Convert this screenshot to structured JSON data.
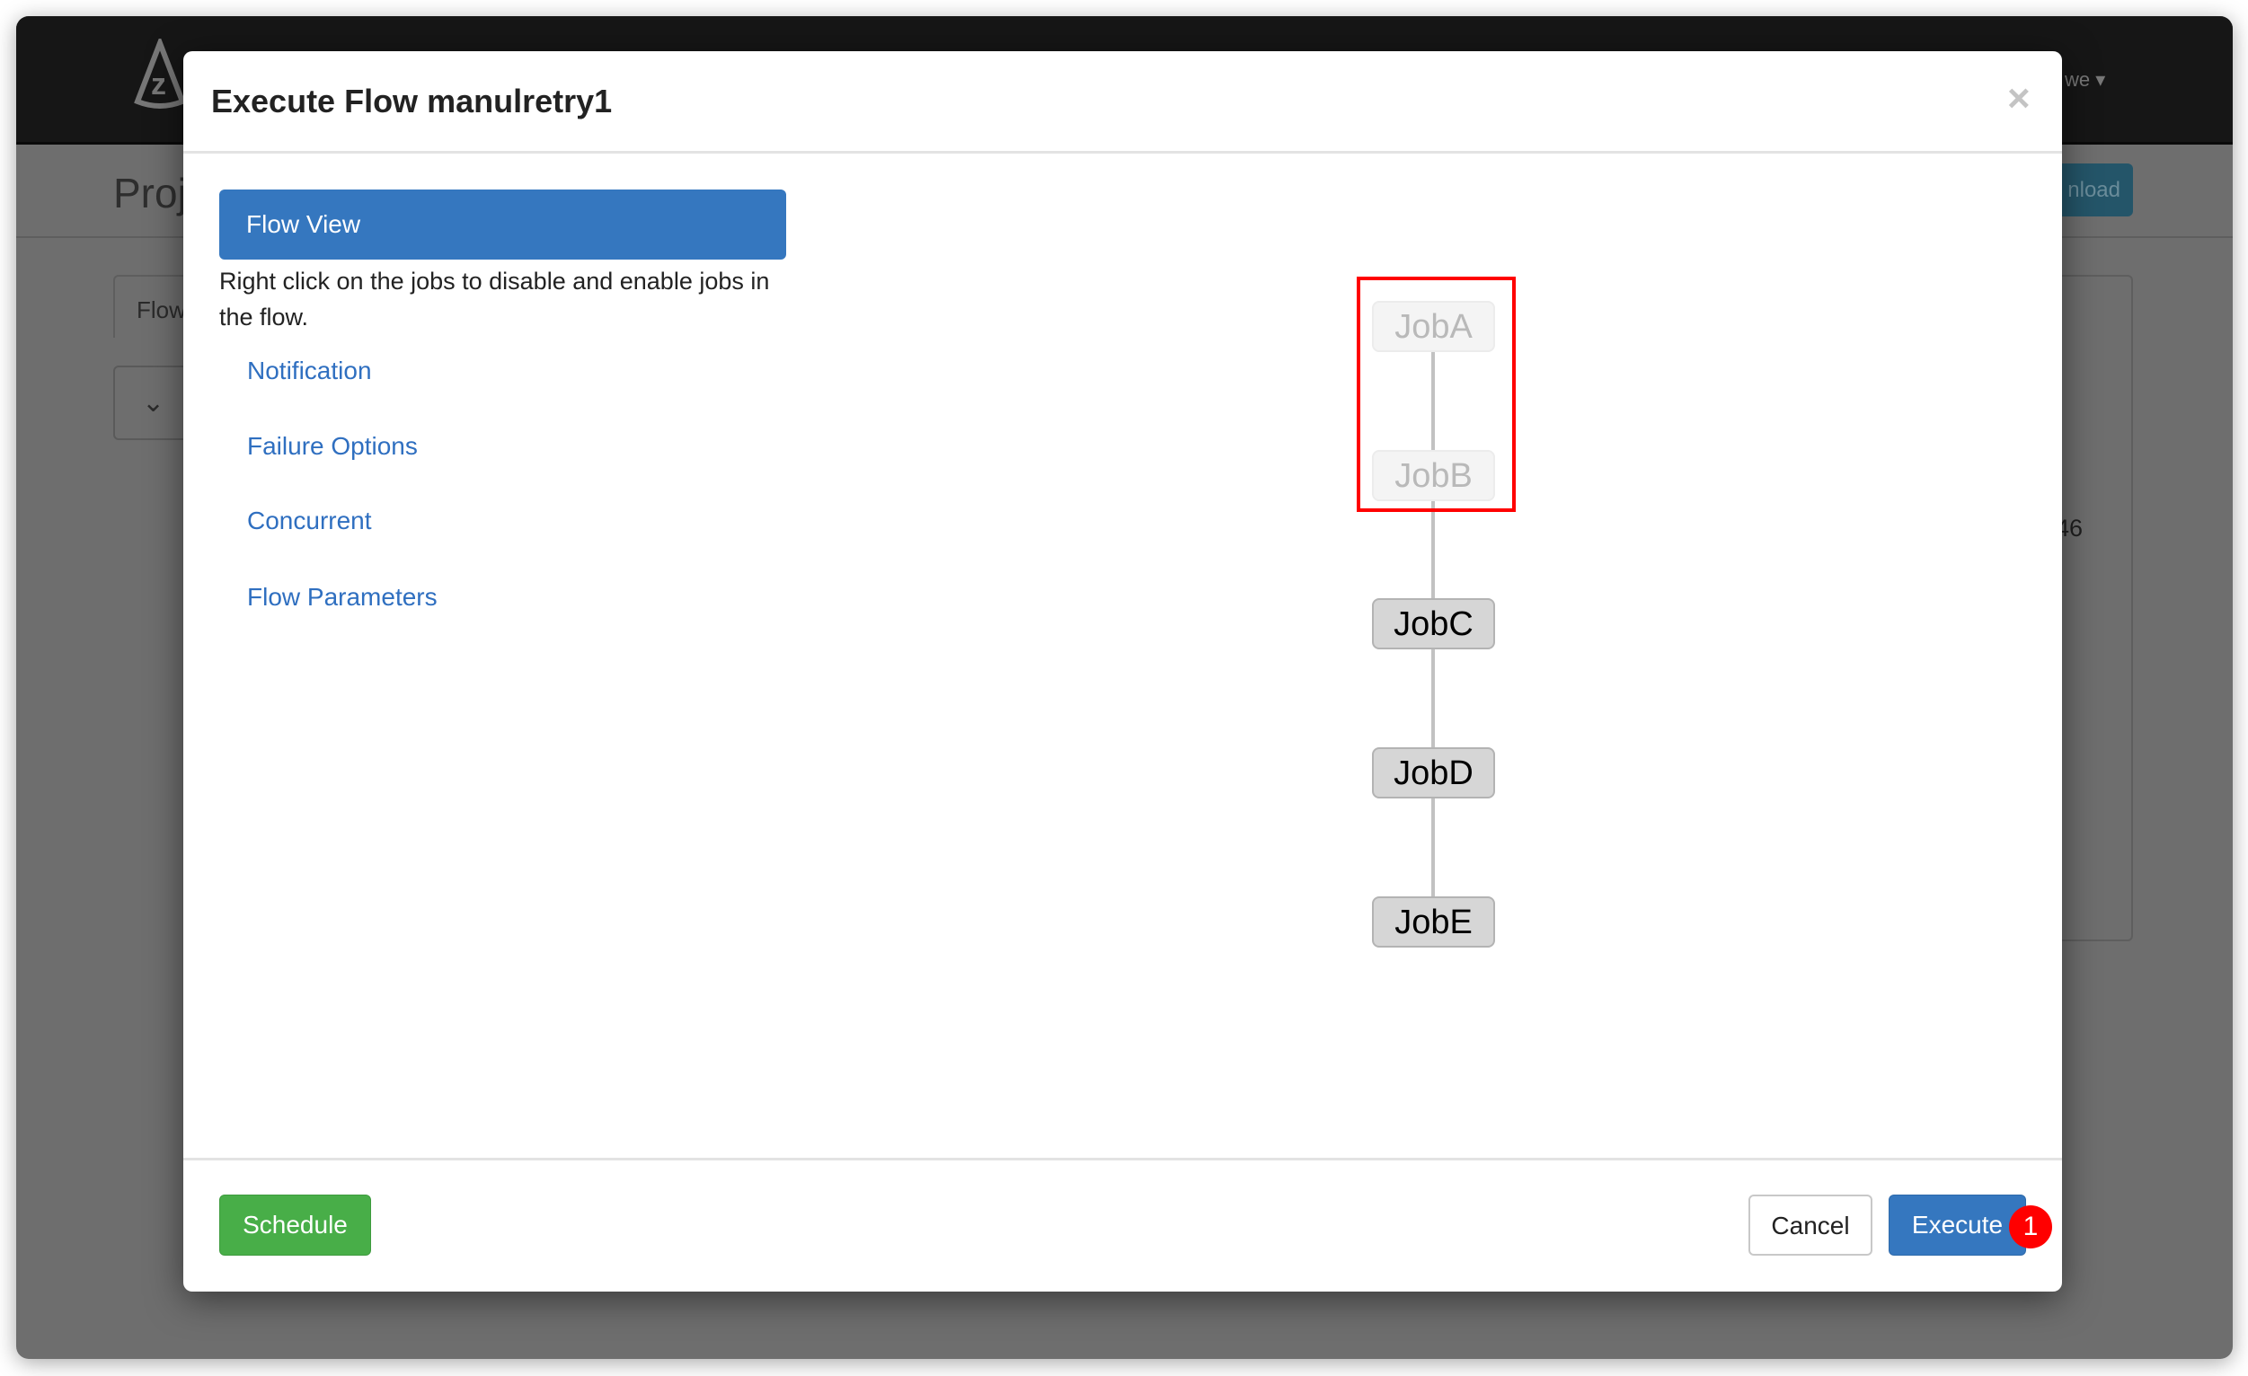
{
  "background": {
    "user_menu": "we ▾",
    "page_title_partial": "Proj",
    "download_button_partial": "nload",
    "tab_partial": "Flow",
    "dropdown_icon": "chevron-down-icon",
    "value_partial": "46"
  },
  "modal": {
    "title": "Execute Flow manulretry1",
    "close_label": "×",
    "sidebar": {
      "active": "Flow View",
      "hint": "Right click on the jobs to disable and enable jobs in the flow.",
      "links": [
        "Notification",
        "Failure Options",
        "Concurrent",
        "Flow Parameters"
      ]
    },
    "graph": {
      "nodes": [
        {
          "label": "JobA",
          "disabled": true
        },
        {
          "label": "JobB",
          "disabled": true
        },
        {
          "label": "JobC",
          "disabled": false
        },
        {
          "label": "JobD",
          "disabled": false
        },
        {
          "label": "JobE",
          "disabled": false
        }
      ],
      "highlight_color": "#ff0000"
    },
    "footer": {
      "schedule": "Schedule",
      "cancel": "Cancel",
      "execute": "Execute",
      "annotation_badge": "1"
    }
  },
  "colors": {
    "primary": "#3577bf",
    "success": "#48ae48",
    "navbar": "#161616"
  }
}
